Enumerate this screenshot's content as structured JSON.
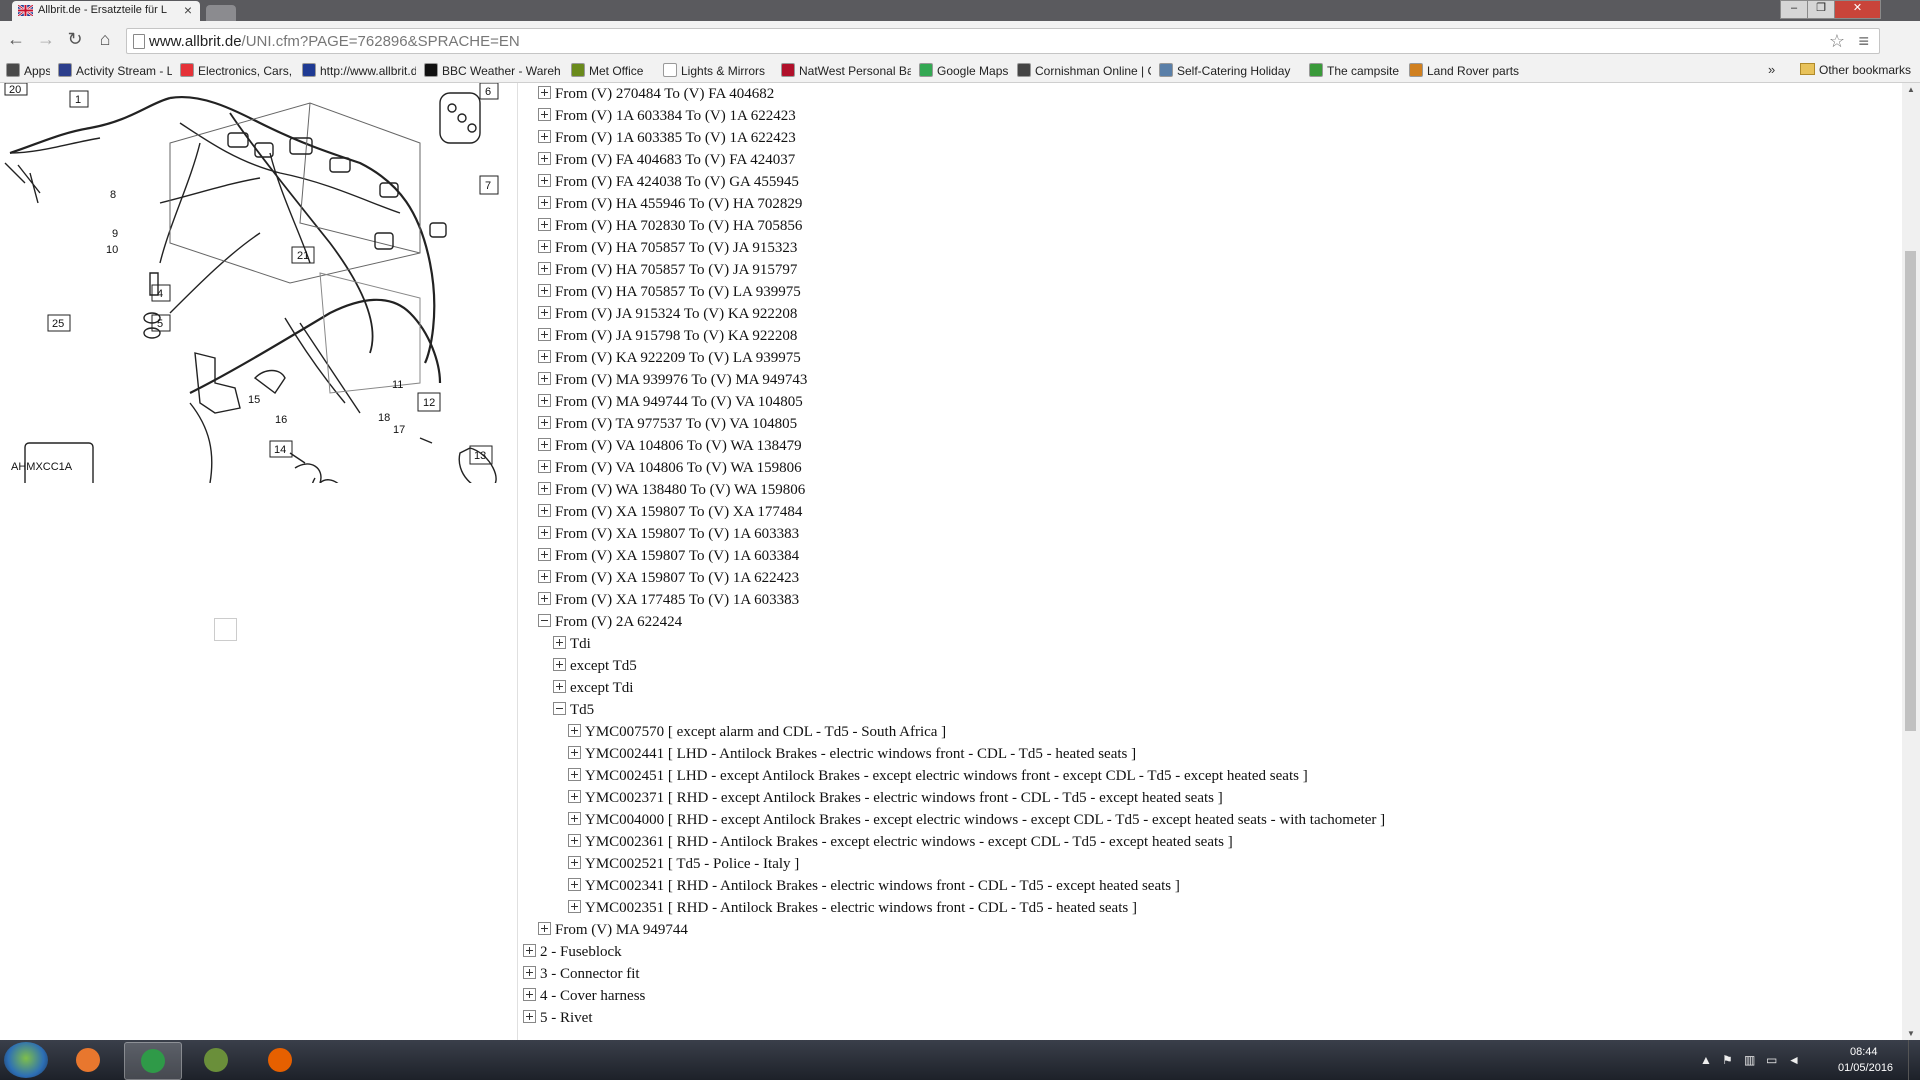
{
  "browser": {
    "tab_title": "Allbrit.de - Ersatzteile für L",
    "tab_close": "×",
    "url_host": "www.allbrit.de",
    "url_path": "/UNI.cfm?PAGE=762896&SPRACHE=EN",
    "window_controls": {
      "minimize": "‒",
      "maximize": "❐",
      "close": "✕"
    }
  },
  "bookmarks": [
    {
      "label": "Apps",
      "icon": "apps-grid-icon",
      "color": "#4a4a4a"
    },
    {
      "label": "Activity Stream - Land",
      "icon": "activity-stream-icon",
      "color": "#2c3e8c"
    },
    {
      "label": "Electronics, Cars, Fash",
      "icon": "ebay-icon",
      "color": "#e53238"
    },
    {
      "label": "http://www.allbrit.de/",
      "icon": "uk-flag-icon",
      "color": "#1f3a93"
    },
    {
      "label": "BBC Weather - Wareh",
      "icon": "bbc-icon",
      "color": "#111111"
    },
    {
      "label": "Met Office",
      "icon": "met-office-icon",
      "color": "#6a8a1c"
    },
    {
      "label": "Lights & Mirrors",
      "icon": "document-icon",
      "color": "#ffffff"
    },
    {
      "label": "NatWest Personal Bar",
      "icon": "natwest-icon",
      "color": "#b0102a"
    },
    {
      "label": "Google Maps",
      "icon": "maps-pin-icon",
      "color": "#34a853"
    },
    {
      "label": "Cornishman Online | C",
      "icon": "news-icon",
      "color": "#444444"
    },
    {
      "label": "Self-Catering Holiday",
      "icon": "globe-icon",
      "color": "#5a7fa8"
    },
    {
      "label": "The campsite",
      "icon": "gear-icon",
      "color": "#3a9a3a"
    },
    {
      "label": "Land Rover parts",
      "icon": "bookmark-doc-icon",
      "color": "#d08020"
    }
  ],
  "bookmarks_more": "»",
  "bookmarks_other": "Other bookmarks",
  "diagram": {
    "code": "AHMXCC1A",
    "callouts": [
      "20",
      "1",
      "6",
      "7",
      "8",
      "9",
      "10",
      "21",
      "4",
      "5",
      "25",
      "11",
      "12",
      "15",
      "16",
      "18",
      "17",
      "14",
      "13"
    ]
  },
  "tree": [
    {
      "label": "From (V) 270484 To (V) FA 404682",
      "depth": 1,
      "state": "plus"
    },
    {
      "label": "From (V) 1A 603384 To (V) 1A 622423",
      "depth": 1,
      "state": "plus"
    },
    {
      "label": "From (V) 1A 603385 To (V) 1A 622423",
      "depth": 1,
      "state": "plus"
    },
    {
      "label": "From (V) FA 404683 To (V) FA 424037",
      "depth": 1,
      "state": "plus"
    },
    {
      "label": "From (V) FA 424038 To (V) GA 455945",
      "depth": 1,
      "state": "plus"
    },
    {
      "label": "From (V) HA 455946 To (V) HA 702829",
      "depth": 1,
      "state": "plus"
    },
    {
      "label": "From (V) HA 702830 To (V) HA 705856",
      "depth": 1,
      "state": "plus"
    },
    {
      "label": "From (V) HA 705857 To (V) JA 915323",
      "depth": 1,
      "state": "plus"
    },
    {
      "label": "From (V) HA 705857 To (V) JA 915797",
      "depth": 1,
      "state": "plus"
    },
    {
      "label": "From (V) HA 705857 To (V) LA 939975",
      "depth": 1,
      "state": "plus"
    },
    {
      "label": "From (V) JA 915324 To (V) KA 922208",
      "depth": 1,
      "state": "plus"
    },
    {
      "label": "From (V) JA 915798 To (V) KA 922208",
      "depth": 1,
      "state": "plus"
    },
    {
      "label": "From (V) KA 922209 To (V) LA 939975",
      "depth": 1,
      "state": "plus"
    },
    {
      "label": "From (V) MA 939976 To (V) MA 949743",
      "depth": 1,
      "state": "plus"
    },
    {
      "label": "From (V) MA 949744 To (V) VA 104805",
      "depth": 1,
      "state": "plus"
    },
    {
      "label": "From (V) TA 977537 To (V) VA 104805",
      "depth": 1,
      "state": "plus"
    },
    {
      "label": "From (V) VA 104806 To (V) WA 138479",
      "depth": 1,
      "state": "plus"
    },
    {
      "label": "From (V) VA 104806 To (V) WA 159806",
      "depth": 1,
      "state": "plus"
    },
    {
      "label": "From (V) WA 138480 To (V) WA 159806",
      "depth": 1,
      "state": "plus"
    },
    {
      "label": "From (V) XA 159807 To (V) XA 177484",
      "depth": 1,
      "state": "plus"
    },
    {
      "label": "From (V) XA 159807 To (V) 1A 603383",
      "depth": 1,
      "state": "plus"
    },
    {
      "label": "From (V) XA 159807 To (V) 1A 603384",
      "depth": 1,
      "state": "plus"
    },
    {
      "label": "From (V) XA 159807 To (V) 1A 622423",
      "depth": 1,
      "state": "plus"
    },
    {
      "label": "From (V) XA 177485 To (V) 1A 603383",
      "depth": 1,
      "state": "plus"
    },
    {
      "label": "From (V) 2A 622424",
      "depth": 1,
      "state": "minus"
    },
    {
      "label": "Tdi",
      "depth": 2,
      "state": "plus"
    },
    {
      "label": "except Td5",
      "depth": 2,
      "state": "plus"
    },
    {
      "label": "except Tdi",
      "depth": 2,
      "state": "plus"
    },
    {
      "label": "Td5",
      "depth": 2,
      "state": "minus"
    },
    {
      "label": "YMC007570 [ except alarm and CDL - Td5 - South Africa ]",
      "depth": 3,
      "state": "plus"
    },
    {
      "label": "YMC002441 [ LHD - Antilock Brakes - electric windows front - CDL - Td5 - heated seats ]",
      "depth": 3,
      "state": "plus"
    },
    {
      "label": "YMC002451 [ LHD - except Antilock Brakes - except electric windows front - except CDL - Td5 - except heated seats ]",
      "depth": 3,
      "state": "plus"
    },
    {
      "label": "YMC002371 [ RHD - except Antilock Brakes - electric windows front - CDL - Td5 - except heated seats ]",
      "depth": 3,
      "state": "plus"
    },
    {
      "label": "YMC004000 [ RHD - except Antilock Brakes - except electric windows - except CDL - Td5 - except heated seats - with tachometer ]",
      "depth": 3,
      "state": "plus"
    },
    {
      "label": "YMC002361 [ RHD - Antilock Brakes - except electric windows - except CDL - Td5 - except heated seats ]",
      "depth": 3,
      "state": "plus"
    },
    {
      "label": "YMC002521 [ Td5 - Police - Italy ]",
      "depth": 3,
      "state": "plus"
    },
    {
      "label": "YMC002341 [ RHD - Antilock Brakes - electric windows front - CDL - Td5 - except heated seats ]",
      "depth": 3,
      "state": "plus"
    },
    {
      "label": "YMC002351 [ RHD - Antilock Brakes - electric windows front - CDL - Td5 - heated seats ]",
      "depth": 3,
      "state": "plus"
    },
    {
      "label": "From (V) MA 949744",
      "depth": 1,
      "state": "plus"
    },
    {
      "label": "2 - Fuseblock",
      "depth": 0,
      "state": "plus"
    },
    {
      "label": "3 - Connector fit",
      "depth": 0,
      "state": "plus"
    },
    {
      "label": "4 - Cover harness",
      "depth": 0,
      "state": "plus"
    },
    {
      "label": "5 - Rivet",
      "depth": 0,
      "state": "plus"
    }
  ],
  "taskbar": {
    "apps": [
      {
        "name": "media-player",
        "icon": "media-player-icon",
        "color": "#e8772e",
        "active": false
      },
      {
        "name": "chrome",
        "icon": "chrome-icon",
        "color": "#2f9a48",
        "active": true
      },
      {
        "name": "control-panel",
        "icon": "control-panel-icon",
        "color": "#6a8f3a",
        "active": false
      },
      {
        "name": "firefox",
        "icon": "firefox-icon",
        "color": "#e66000",
        "active": false
      }
    ],
    "time": "08:44",
    "date": "01/05/2016"
  }
}
